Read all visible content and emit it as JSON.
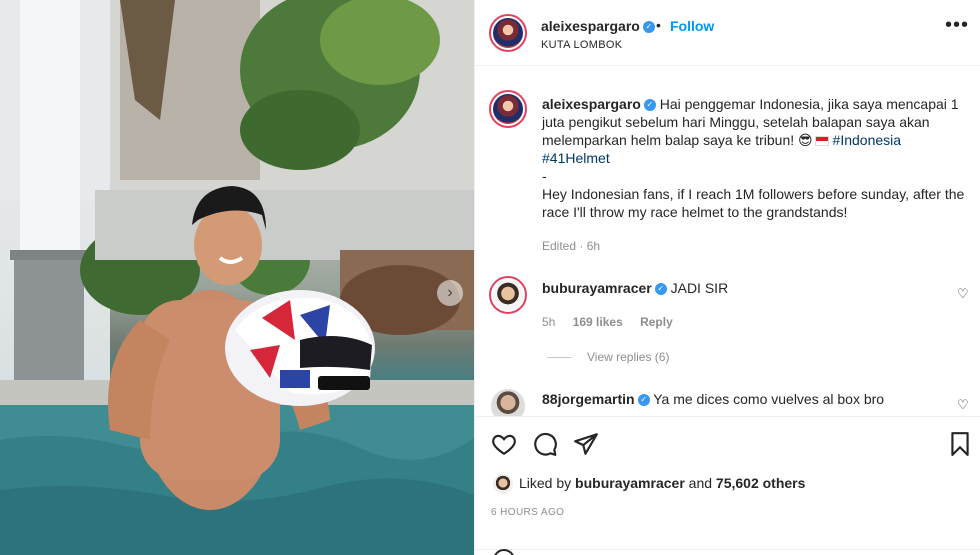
{
  "post": {
    "author": "aleixespargaro",
    "follow_label": "Follow",
    "separator": "•",
    "location": "KUTA LOMBOK",
    "more_label": "•••",
    "verified_mark": "✓"
  },
  "caption": {
    "author": "aleixespargaro",
    "text_id": "Hai penggemar Indonesia, jika saya mencapai 1 juta pengikut sebelum hari Minggu, setelah balapan saya akan melemparkan helm balap saya ke tribun!",
    "emoji": "😎",
    "hashtag1": "#Indonesia",
    "hashtag2": "#41Helmet",
    "dash": "-",
    "text_en": "Hey Indonesian fans, if I reach 1M followers before sunday, after the race I'll throw my race helmet to the grandstands!",
    "edited": "Edited · 6h"
  },
  "comments": [
    {
      "author": "buburayamracer",
      "text": "JADI SIR",
      "age": "5h",
      "likes": "169 likes",
      "reply_label": "Reply",
      "view_replies": "View replies (6)"
    },
    {
      "author": "88jorgemartin",
      "text": "Ya me dices como vuelves al box bro"
    }
  ],
  "actions": {
    "like_icon": "heart-outline-icon",
    "comment_icon": "comment-bubble-icon",
    "share_icon": "paper-plane-icon",
    "save_icon": "bookmark-icon"
  },
  "likes": {
    "prefix": "Liked by",
    "user": "buburayamracer",
    "joiner": "and",
    "count": "75,602 others"
  },
  "timestamp": "6 HOURS AGO",
  "carousel_next": "›",
  "heart_glyph": "♡",
  "colors": {
    "accent": "#0095f6",
    "verified": "#3897f0",
    "hashtag": "#00376b",
    "secondary_text": "#8e8e8e"
  }
}
